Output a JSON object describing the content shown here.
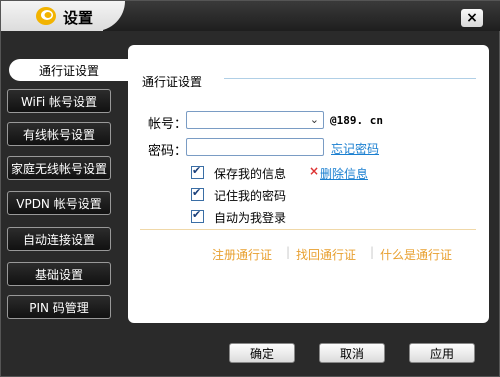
{
  "window": {
    "title": "设置",
    "close_label": "×"
  },
  "sidebar": {
    "items": [
      {
        "label": "通行证设置",
        "active": true
      },
      {
        "label": "WiFi 帐号设置"
      },
      {
        "label": "有线帐号设置"
      },
      {
        "label": "家庭无线帐号设置"
      },
      {
        "label": "VPDN 帐号设置"
      },
      {
        "label": "自动连接设置"
      },
      {
        "label": "基础设置"
      },
      {
        "label": "PIN 码管理"
      }
    ]
  },
  "panel": {
    "section_title": "通行证设置",
    "account_label": "帐号：",
    "account_value": "",
    "domain_suffix": "@189. cn",
    "password_label": "密码：",
    "password_value": "",
    "forgot_password": "忘记密码",
    "checks": [
      {
        "label": "保存我的信息",
        "checked": true
      },
      {
        "label": "记住我的密码",
        "checked": true
      },
      {
        "label": "自动为我登录",
        "checked": true
      }
    ],
    "delete_info": "删除信息",
    "links": [
      "注册通行证",
      "找回通行证",
      "什么是通行证"
    ],
    "separator": "|"
  },
  "footer": {
    "ok": "确定",
    "cancel": "取消",
    "apply": "应用"
  },
  "colors": {
    "link": "#1a7fd0",
    "accent_link": "#e8a030",
    "nav_dark": "#111111"
  }
}
